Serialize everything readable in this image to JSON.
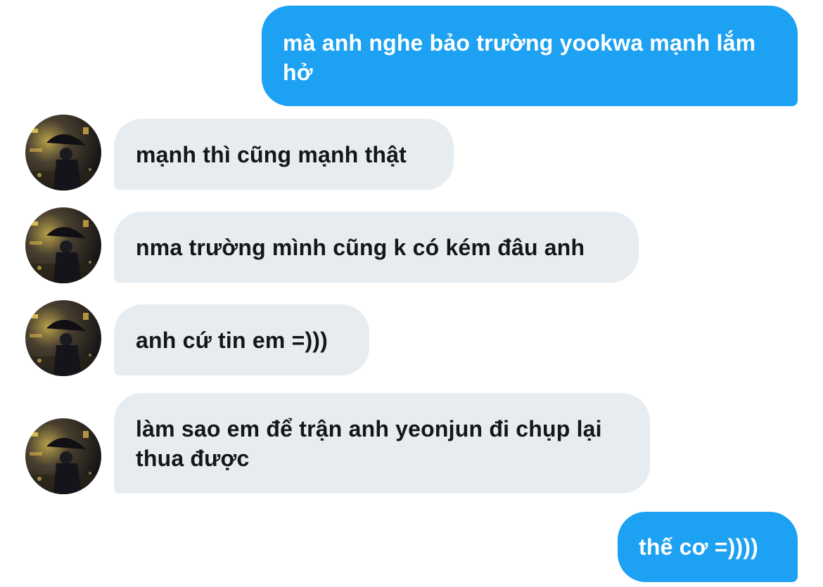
{
  "conversation": {
    "messages": [
      {
        "direction": "outgoing",
        "text": "mà anh nghe bảo trường yookwa mạnh lắm hở"
      },
      {
        "direction": "incoming",
        "text": "mạnh thì cũng mạnh thật"
      },
      {
        "direction": "incoming",
        "text": "nma trường mình cũng k có kém đâu anh"
      },
      {
        "direction": "incoming",
        "text": "anh cứ tin em =)))"
      },
      {
        "direction": "incoming",
        "text": "làm sao em để trận anh yeonjun đi chụp lại thua được"
      },
      {
        "direction": "outgoing",
        "text": "thế cơ =))))"
      }
    ]
  },
  "colors": {
    "outgoing_bubble": "#1da1f2",
    "incoming_bubble": "#e6ecf0",
    "outgoing_text": "#ffffff",
    "incoming_text": "#14171a"
  },
  "icons": {
    "avatar": "profile-photo-person-with-umbrella-night"
  }
}
